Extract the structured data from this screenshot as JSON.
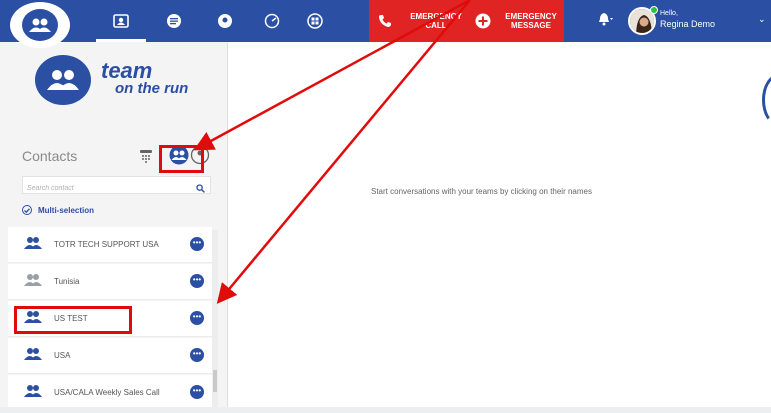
{
  "topbar": {
    "emergency_call": "EMERGENCY CALL",
    "emergency_message": "EMERGENCY MESSAGE",
    "greeting": "Hello,",
    "user_name": "Regina Demo",
    "colors": {
      "bar": "#2b4fa3",
      "emergency": "#e02424"
    }
  },
  "brand": {
    "line1": "team",
    "line2": "on the run"
  },
  "contacts": {
    "title": "Contacts",
    "search_placeholder": "Search contact",
    "multi_selection": "Multi-selection",
    "items": [
      {
        "label": "TOTR TECH SUPPORT USA",
        "icon": "group-icon"
      },
      {
        "label": "Tunisia",
        "icon": "group-icon"
      },
      {
        "label": "US TEST",
        "icon": "group-icon"
      },
      {
        "label": "USA",
        "icon": "group-icon"
      },
      {
        "label": "USA/CALA Weekly Sales Call",
        "icon": "group-icon"
      }
    ]
  },
  "main": {
    "empty_message": "Start conversations with your teams by clicking on their names"
  },
  "annotation": {
    "highlight_color": "#e00b0b"
  }
}
